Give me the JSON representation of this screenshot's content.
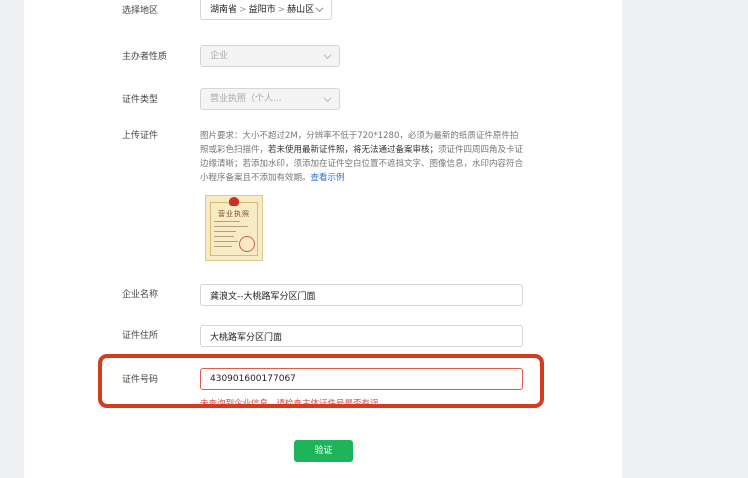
{
  "form": {
    "region": {
      "label": "选择地区",
      "province": "湖南省",
      "city": "益阳市",
      "district": "赫山区",
      "separator": ">"
    },
    "organizer_type": {
      "label": "主办者性质",
      "value": "企业"
    },
    "cert_type": {
      "label": "证件类型",
      "value": "营业执照（个人..."
    },
    "upload": {
      "label": "上传证件",
      "requirement_prefix": "图片要求：大小不超过2M，分辨率不低于720*1280，必须为最新的纸质证件原件拍照或彩色扫描件，",
      "requirement_bold": "若未使用最新证件照，将无法通过备案审核；",
      "requirement_suffix": "须证件四周四角及卡证边缘清晰；若添加水印，须添加在证件空白位置不遮挡文字、图像信息，水印内容符合小程序备案且不添加有效期。",
      "example_link": "查看示例",
      "image_title": "营业执照"
    },
    "company_name": {
      "label": "企业名称",
      "value": "龚浪文--大桃路军分区门面"
    },
    "cert_address": {
      "label": "证件住所",
      "value": "大桃路军分区门面"
    },
    "cert_number": {
      "label": "证件号码",
      "value": "430901600177067",
      "error": "未查询到企业信息，请检查主体证件号是否有误"
    },
    "submit_label": "验证"
  },
  "colors": {
    "primary_button": "#1fb45a",
    "error": "#e0483c",
    "highlight_border": "#d63a20",
    "link": "#2b6fd6"
  }
}
